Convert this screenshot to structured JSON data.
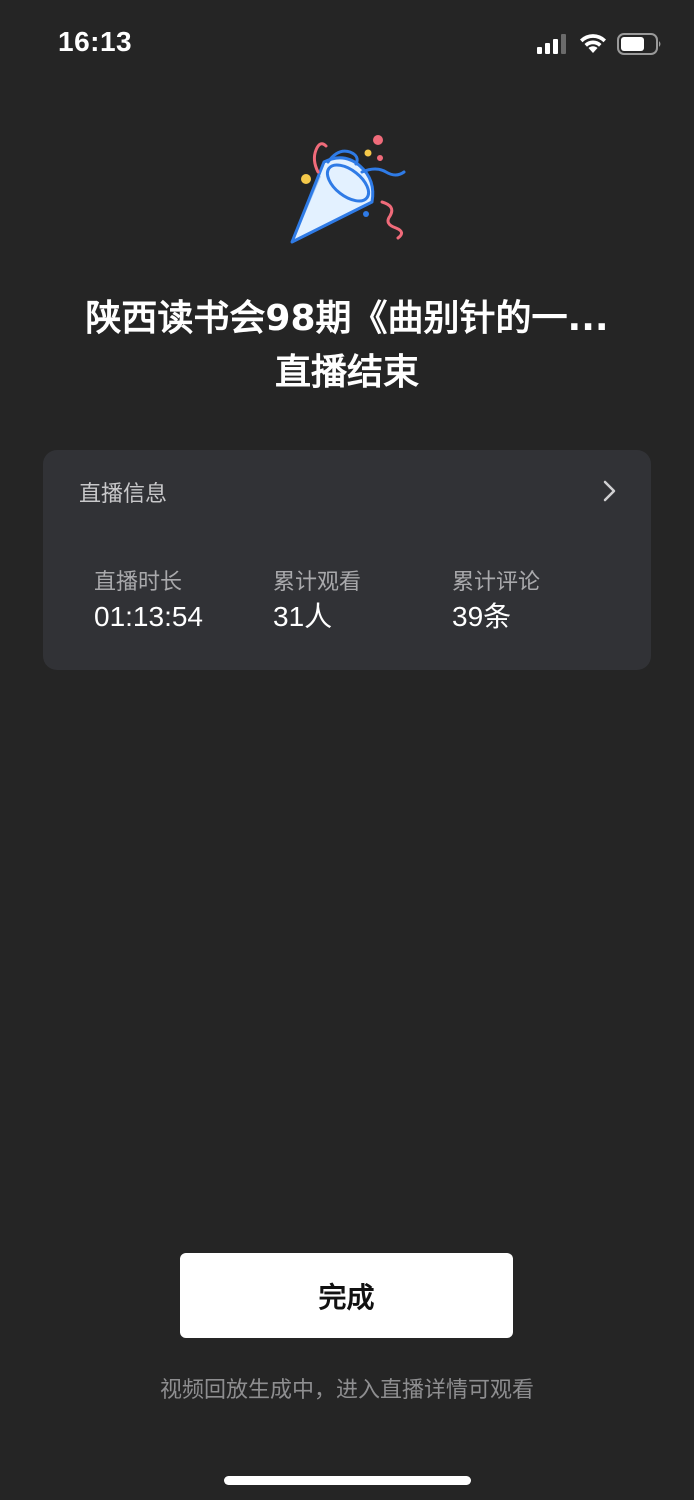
{
  "status_bar": {
    "time": "16:13",
    "icons": [
      "signal-icon",
      "wifi-icon",
      "battery-icon"
    ]
  },
  "header": {
    "icon": "party-popper-icon",
    "title_line1": "陕西读书会98期《曲别针的一...",
    "title_line2": "直播结束"
  },
  "info_card": {
    "title": "直播信息",
    "chevron": "chevron-right-icon",
    "stats": [
      {
        "label": "直播时长",
        "value": "01:13:54"
      },
      {
        "label": "累计观看",
        "value": "31人"
      },
      {
        "label": "累计评论",
        "value": "39条"
      }
    ]
  },
  "footer": {
    "done_label": "完成",
    "hint": "视频回放生成中，进入直播详情可观看"
  },
  "colors": {
    "background": "#252525",
    "card": "#313236",
    "button": "#ffffff"
  }
}
